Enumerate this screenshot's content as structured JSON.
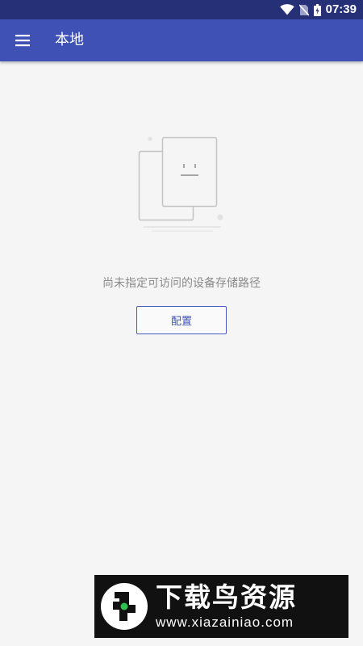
{
  "status_bar": {
    "time": "07:39",
    "icons": [
      "wifi-icon",
      "no-sim-icon",
      "battery-icon"
    ]
  },
  "app_bar": {
    "title": "本地",
    "menu_icon": "menu-icon"
  },
  "empty_state": {
    "illustration": "empty-document-icon",
    "message": "尚未指定可访问的设备存储路径",
    "button_label": "配置"
  },
  "watermark": {
    "title": "下载鸟资源",
    "url": "www.xiazainiao.com"
  },
  "colors": {
    "status_bar": "#263076",
    "app_bar": "#3f51b5",
    "accent": "#3f51b5",
    "background": "#f5f5f5"
  }
}
